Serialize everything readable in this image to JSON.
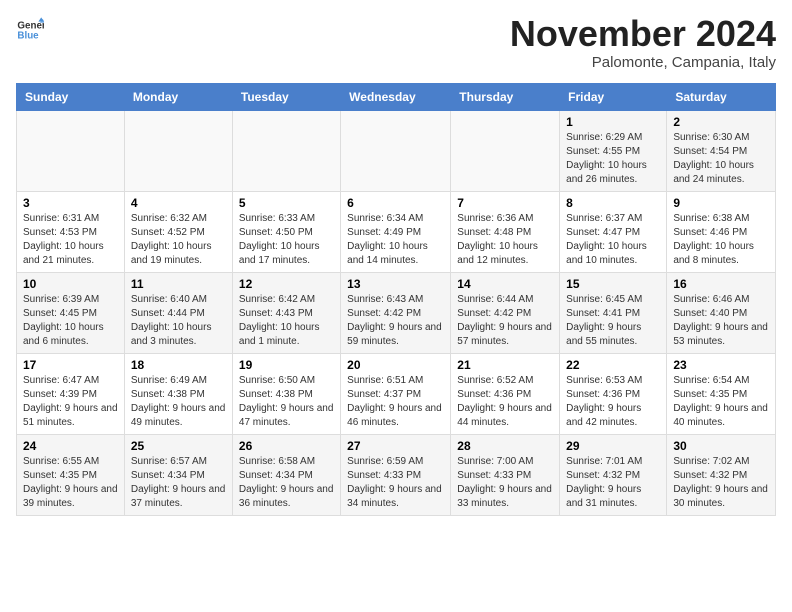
{
  "logo": {
    "line1": "General",
    "line2": "Blue"
  },
  "title": "November 2024",
  "subtitle": "Palomonte, Campania, Italy",
  "weekdays": [
    "Sunday",
    "Monday",
    "Tuesday",
    "Wednesday",
    "Thursday",
    "Friday",
    "Saturday"
  ],
  "weeks": [
    [
      {
        "day": "",
        "info": ""
      },
      {
        "day": "",
        "info": ""
      },
      {
        "day": "",
        "info": ""
      },
      {
        "day": "",
        "info": ""
      },
      {
        "day": "",
        "info": ""
      },
      {
        "day": "1",
        "info": "Sunrise: 6:29 AM\nSunset: 4:55 PM\nDaylight: 10 hours and 26 minutes."
      },
      {
        "day": "2",
        "info": "Sunrise: 6:30 AM\nSunset: 4:54 PM\nDaylight: 10 hours and 24 minutes."
      }
    ],
    [
      {
        "day": "3",
        "info": "Sunrise: 6:31 AM\nSunset: 4:53 PM\nDaylight: 10 hours and 21 minutes."
      },
      {
        "day": "4",
        "info": "Sunrise: 6:32 AM\nSunset: 4:52 PM\nDaylight: 10 hours and 19 minutes."
      },
      {
        "day": "5",
        "info": "Sunrise: 6:33 AM\nSunset: 4:50 PM\nDaylight: 10 hours and 17 minutes."
      },
      {
        "day": "6",
        "info": "Sunrise: 6:34 AM\nSunset: 4:49 PM\nDaylight: 10 hours and 14 minutes."
      },
      {
        "day": "7",
        "info": "Sunrise: 6:36 AM\nSunset: 4:48 PM\nDaylight: 10 hours and 12 minutes."
      },
      {
        "day": "8",
        "info": "Sunrise: 6:37 AM\nSunset: 4:47 PM\nDaylight: 10 hours and 10 minutes."
      },
      {
        "day": "9",
        "info": "Sunrise: 6:38 AM\nSunset: 4:46 PM\nDaylight: 10 hours and 8 minutes."
      }
    ],
    [
      {
        "day": "10",
        "info": "Sunrise: 6:39 AM\nSunset: 4:45 PM\nDaylight: 10 hours and 6 minutes."
      },
      {
        "day": "11",
        "info": "Sunrise: 6:40 AM\nSunset: 4:44 PM\nDaylight: 10 hours and 3 minutes."
      },
      {
        "day": "12",
        "info": "Sunrise: 6:42 AM\nSunset: 4:43 PM\nDaylight: 10 hours and 1 minute."
      },
      {
        "day": "13",
        "info": "Sunrise: 6:43 AM\nSunset: 4:42 PM\nDaylight: 9 hours and 59 minutes."
      },
      {
        "day": "14",
        "info": "Sunrise: 6:44 AM\nSunset: 4:42 PM\nDaylight: 9 hours and 57 minutes."
      },
      {
        "day": "15",
        "info": "Sunrise: 6:45 AM\nSunset: 4:41 PM\nDaylight: 9 hours and 55 minutes."
      },
      {
        "day": "16",
        "info": "Sunrise: 6:46 AM\nSunset: 4:40 PM\nDaylight: 9 hours and 53 minutes."
      }
    ],
    [
      {
        "day": "17",
        "info": "Sunrise: 6:47 AM\nSunset: 4:39 PM\nDaylight: 9 hours and 51 minutes."
      },
      {
        "day": "18",
        "info": "Sunrise: 6:49 AM\nSunset: 4:38 PM\nDaylight: 9 hours and 49 minutes."
      },
      {
        "day": "19",
        "info": "Sunrise: 6:50 AM\nSunset: 4:38 PM\nDaylight: 9 hours and 47 minutes."
      },
      {
        "day": "20",
        "info": "Sunrise: 6:51 AM\nSunset: 4:37 PM\nDaylight: 9 hours and 46 minutes."
      },
      {
        "day": "21",
        "info": "Sunrise: 6:52 AM\nSunset: 4:36 PM\nDaylight: 9 hours and 44 minutes."
      },
      {
        "day": "22",
        "info": "Sunrise: 6:53 AM\nSunset: 4:36 PM\nDaylight: 9 hours and 42 minutes."
      },
      {
        "day": "23",
        "info": "Sunrise: 6:54 AM\nSunset: 4:35 PM\nDaylight: 9 hours and 40 minutes."
      }
    ],
    [
      {
        "day": "24",
        "info": "Sunrise: 6:55 AM\nSunset: 4:35 PM\nDaylight: 9 hours and 39 minutes."
      },
      {
        "day": "25",
        "info": "Sunrise: 6:57 AM\nSunset: 4:34 PM\nDaylight: 9 hours and 37 minutes."
      },
      {
        "day": "26",
        "info": "Sunrise: 6:58 AM\nSunset: 4:34 PM\nDaylight: 9 hours and 36 minutes."
      },
      {
        "day": "27",
        "info": "Sunrise: 6:59 AM\nSunset: 4:33 PM\nDaylight: 9 hours and 34 minutes."
      },
      {
        "day": "28",
        "info": "Sunrise: 7:00 AM\nSunset: 4:33 PM\nDaylight: 9 hours and 33 minutes."
      },
      {
        "day": "29",
        "info": "Sunrise: 7:01 AM\nSunset: 4:32 PM\nDaylight: 9 hours and 31 minutes."
      },
      {
        "day": "30",
        "info": "Sunrise: 7:02 AM\nSunset: 4:32 PM\nDaylight: 9 hours and 30 minutes."
      }
    ]
  ]
}
